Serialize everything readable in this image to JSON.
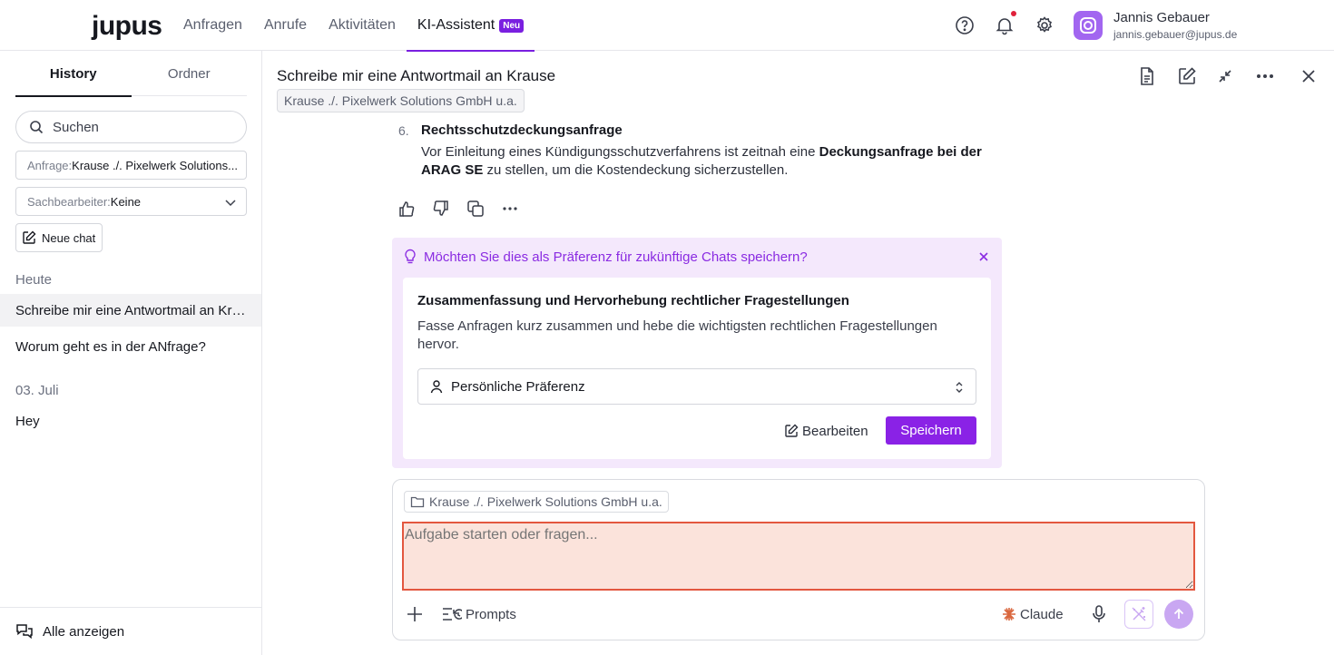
{
  "colors": {
    "accent": "#8a22e6",
    "pref_bg": "#f4e8fc",
    "input_bg": "#fbe3db",
    "input_border": "#e3573f",
    "notif": "#e0213b"
  },
  "topbar": {
    "logo": "jupus",
    "nav": [
      {
        "label": "Anfragen"
      },
      {
        "label": "Anrufe"
      },
      {
        "label": "Aktivitäten"
      },
      {
        "label": "KI-Assistent",
        "badge": "Neu",
        "active": true
      }
    ],
    "icons": [
      "help-icon",
      "bell-icon",
      "gear-icon"
    ],
    "user": {
      "name": "Jannis Gebauer",
      "email": "jannis.gebauer@jupus.de"
    }
  },
  "sidebar": {
    "tabs": [
      {
        "label": "History",
        "active": true
      },
      {
        "label": "Ordner"
      }
    ],
    "search_placeholder": "Suchen",
    "filter_anfrage": {
      "label": "Anfrage:",
      "value": "Krause ./. Pixelwerk Solutions..."
    },
    "filter_sachbearbeiter": {
      "label": "Sachbearbeiter:",
      "value": "Keine"
    },
    "new_chat": "Neue chat",
    "sections": [
      {
        "title": "Heute",
        "items": [
          "Schreibe mir eine Antwortmail an Krause",
          "Worum geht es in der ANfrage?"
        ]
      },
      {
        "title": "03. Juli",
        "items": [
          "Hey"
        ]
      }
    ],
    "show_all": "Alle anzeigen"
  },
  "chat": {
    "title": "Schreibe mir eine Antwortmail an Krause",
    "chip": "Krause ./. Pixelwerk Solutions GmbH u.a.",
    "list_item": {
      "number": "6.",
      "heading": "Rechtsschutzdeckungsanfrage",
      "text_1": "Vor Einleitung eines Kündigungsschutzverfahrens ist zeitnah eine ",
      "bold": "Deckungsanfrage bei der ARAG SE",
      "text_2": " zu stellen, um die Kostendeckung sicherzustellen."
    },
    "preference": {
      "question": "Möchten Sie dies als Präferenz für zukünftige Chats speichern?",
      "title": "Zusammenfassung und Hervorhebung rechtlicher Fragestellungen",
      "description": "Fasse Anfragen kurz zusammen und hebe die wichtigsten rechtlichen Fragestellungen hervor.",
      "scope": "Persönliche Präferenz",
      "edit_label": "Bearbeiten",
      "save_label": "Speichern"
    }
  },
  "composer": {
    "chip": "Krause ./. Pixelwerk Solutions GmbH u.a.",
    "placeholder": "Aufgabe starten oder fragen...",
    "prompts_label": "Prompts",
    "model": "Claude"
  }
}
